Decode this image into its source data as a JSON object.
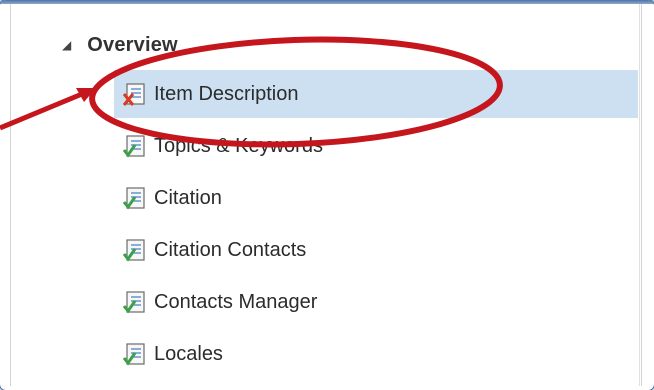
{
  "tree": {
    "group": {
      "label": "Overview",
      "expanded_glyph": "◢"
    },
    "items": [
      {
        "label": "Item Description",
        "status": "incomplete",
        "icon": "page-error-icon",
        "selected": true
      },
      {
        "label": "Topics & Keywords",
        "status": "complete",
        "icon": "page-check-icon",
        "selected": false
      },
      {
        "label": "Citation",
        "status": "complete",
        "icon": "page-check-icon",
        "selected": false
      },
      {
        "label": "Citation Contacts",
        "status": "complete",
        "icon": "page-check-icon",
        "selected": false
      },
      {
        "label": "Contacts Manager",
        "status": "complete",
        "icon": "page-check-icon",
        "selected": false
      },
      {
        "label": "Locales",
        "status": "complete",
        "icon": "page-check-icon",
        "selected": false
      }
    ]
  },
  "colors": {
    "selection": "#cde0f2",
    "annotation": "#c4161c",
    "check": "#3aa14a",
    "error": "#d83b1f"
  }
}
